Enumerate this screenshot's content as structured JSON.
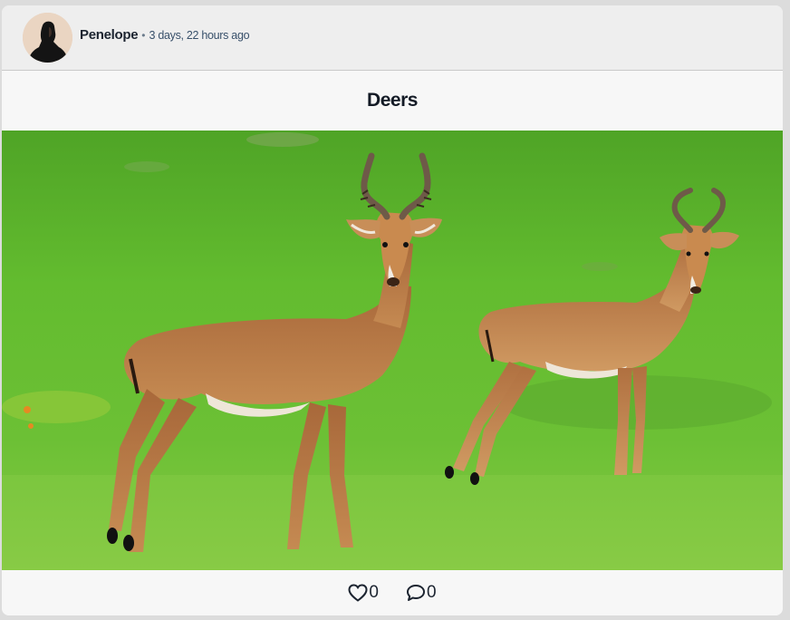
{
  "post": {
    "author": "Penelope",
    "separator": "•",
    "timestamp": "3 days, 22 hours ago",
    "title": "Deers",
    "image_subject": "two impalas standing on green grass"
  },
  "actions": {
    "like_icon": "heart-icon",
    "like_count": "0",
    "comment_icon": "comment-bubble-icon",
    "comment_count": "0"
  },
  "colors": {
    "page_background": "#dcdcdc",
    "card_background": "#f7f7f7",
    "header_background": "#eeeeee",
    "text_dark": "#1c2430",
    "timestamp_text": "#38506a"
  }
}
